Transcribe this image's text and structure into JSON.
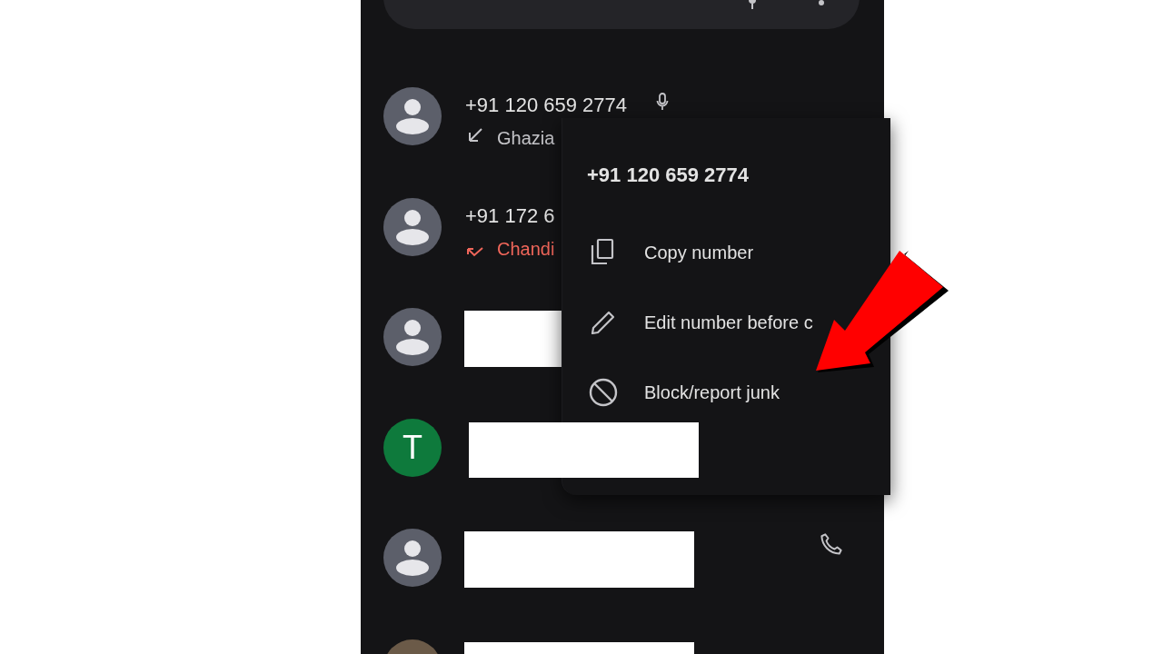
{
  "rows": [
    {
      "kind": "call",
      "avatar": {
        "kind": "person"
      },
      "number": "+91 120 659 2774",
      "voicemail": true,
      "missed": false,
      "location": "Ghazia",
      "call_button": false
    },
    {
      "kind": "call",
      "avatar": {
        "kind": "person"
      },
      "number": "+91 172 6",
      "voicemail": false,
      "missed": true,
      "location": "Chandi",
      "call_button": false
    },
    {
      "kind": "redacted",
      "avatar": {
        "kind": "person"
      },
      "call_button": false
    },
    {
      "kind": "redacted",
      "avatar": {
        "kind": "letter",
        "letter": "T",
        "color": "#0e7a3c"
      },
      "call_button": false
    },
    {
      "kind": "redacted",
      "avatar": {
        "kind": "person"
      },
      "call_button": true
    },
    {
      "kind": "redacted",
      "avatar": {
        "kind": "photo"
      },
      "call_button": false
    }
  ],
  "context_menu": {
    "title": "+91 120 659 2774",
    "items": [
      {
        "kind": "copy",
        "label": "Copy number"
      },
      {
        "kind": "edit",
        "label": "Edit number before c"
      },
      {
        "kind": "block",
        "label": "Block/report junk"
      }
    ]
  }
}
